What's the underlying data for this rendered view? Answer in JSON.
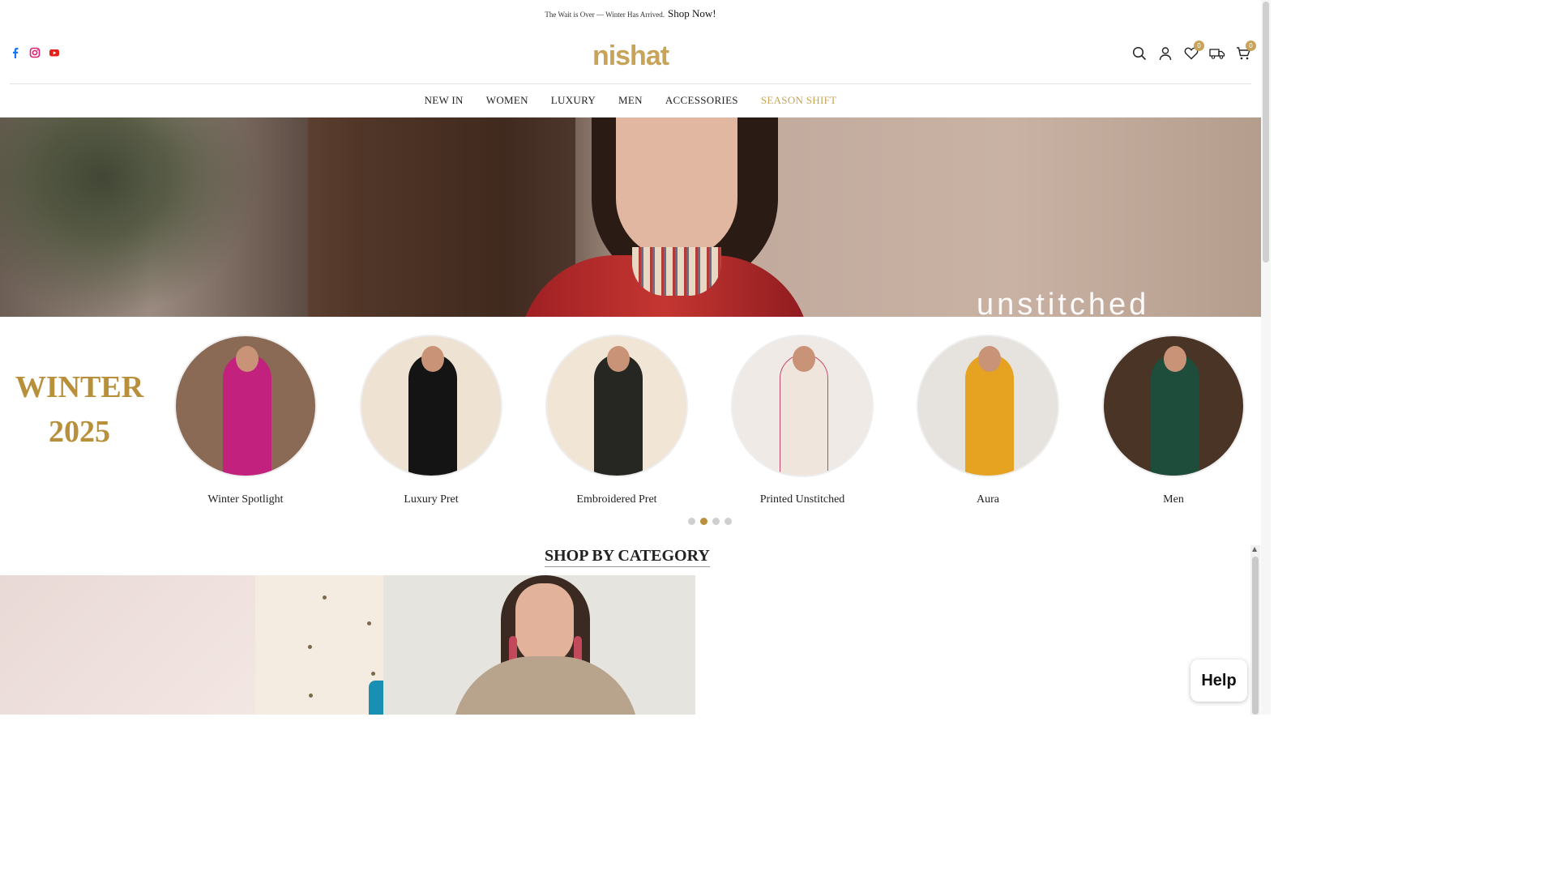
{
  "announcement": {
    "text": "The Wait is Over — Winter Has Arrived.",
    "link": "Shop Now!"
  },
  "header": {
    "logo": "nishat",
    "social": [
      "facebook-icon",
      "instagram-icon",
      "youtube-icon"
    ],
    "wishlist_count": "0",
    "cart_count": "0"
  },
  "nav": {
    "items": [
      {
        "label": "NEW IN"
      },
      {
        "label": "WOMEN"
      },
      {
        "label": "LUXURY"
      },
      {
        "label": "MEN"
      },
      {
        "label": "ACCESSORIES"
      },
      {
        "label": "SEASON SHIFT",
        "accent": "#c7a45a"
      }
    ]
  },
  "hero": {
    "overlay_text": "unstitched"
  },
  "season": {
    "line1": "WINTER",
    "line2": "2025",
    "color": "#b8903c"
  },
  "collections": [
    {
      "label": "Winter Spotlight",
      "color": "#c2217e"
    },
    {
      "label": "Luxury Pret",
      "color": "#141414"
    },
    {
      "label": "Embroidered Pret",
      "color": "#262623"
    },
    {
      "label": "Printed Unstitched",
      "color": "#efe5dc"
    },
    {
      "label": "Aura",
      "color": "#e5a321"
    },
    {
      "label": "Men",
      "color": "#1f4d3b"
    }
  ],
  "carousel": {
    "pages": 4,
    "active_page": 2
  },
  "section": {
    "title": "SHOP BY CATEGORY"
  },
  "help": {
    "label": "Help"
  }
}
